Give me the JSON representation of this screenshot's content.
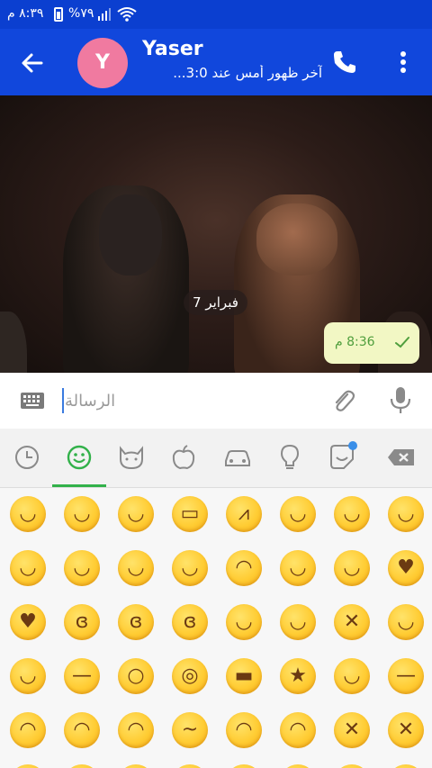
{
  "status_bar": {
    "time": "٨:٣٩ م",
    "battery": "%٧٩",
    "signal_icon": "signal-icon",
    "wifi_icon": "wifi-icon"
  },
  "header": {
    "avatar_letter": "Y",
    "contact_name": "Yaser",
    "last_seen": "آخر ظهور أمس عند 3:0...",
    "avatar_color": "#f07aa0",
    "bar_color": "#1147dc"
  },
  "chat": {
    "date_chip": "فبراير 7",
    "message_time": "8:36 م",
    "bubble_color": "#f2f7c4"
  },
  "input": {
    "placeholder": "الرسالة"
  },
  "emoji_tabs": [
    {
      "icon": "clock-icon",
      "selected": false
    },
    {
      "icon": "smiley-icon",
      "selected": true
    },
    {
      "icon": "cat-icon",
      "selected": false
    },
    {
      "icon": "apple-icon",
      "selected": false
    },
    {
      "icon": "car-icon",
      "selected": false
    },
    {
      "icon": "lightbulb-icon",
      "selected": false
    },
    {
      "icon": "sticker-icon",
      "selected": false
    },
    {
      "icon": "backspace-icon",
      "selected": false
    }
  ],
  "emoji_rows": [
    [
      "grinning",
      "smiley",
      "smile",
      "grin",
      "laughing",
      "sweat-smile",
      "joy",
      "rofl"
    ],
    [
      "relaxed",
      "blush",
      "innocent",
      "slightly-smiling",
      "upside-down",
      "wink",
      "relieved",
      "heart-eyes"
    ],
    [
      "kissing-heart",
      "kissing",
      "kissing-smiling-eyes",
      "kissing-closed-eyes",
      "yum",
      "tongue",
      "squinting-tongue",
      "winking-tongue"
    ],
    [
      "zany",
      "raised-eyebrow",
      "monocle",
      "nerd",
      "sunglasses",
      "star-struck",
      "smirk",
      "unamused"
    ],
    [
      "disappointed",
      "pensive",
      "worried",
      "confused",
      "slightly-frowning",
      "frowning",
      "persevering",
      "confounded"
    ]
  ]
}
